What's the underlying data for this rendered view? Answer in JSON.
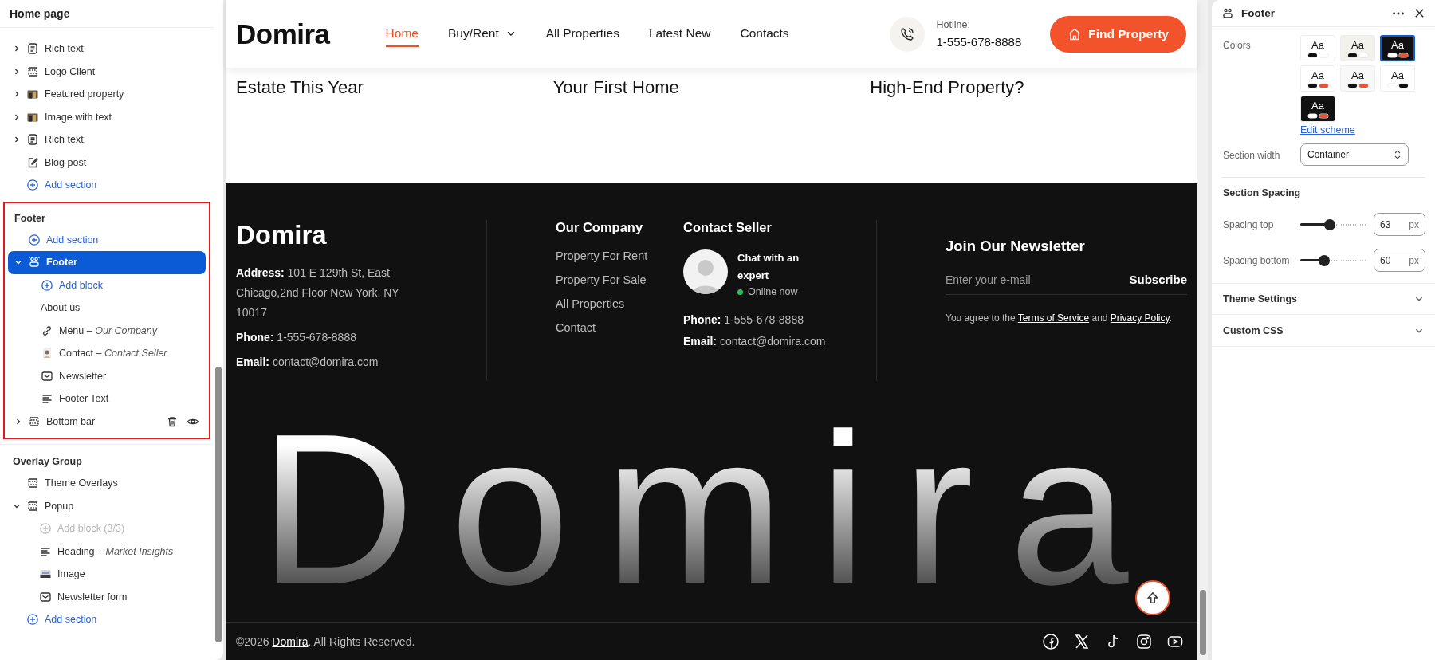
{
  "sidebar": {
    "title": "Home page",
    "sections": [
      {
        "kind": "richtext",
        "label": "Rich text",
        "expanded": false,
        "selected": false
      },
      {
        "kind": "group",
        "label": "Logo Client",
        "expanded": false,
        "selected": false
      },
      {
        "kind": "photo",
        "label": "Featured property",
        "expanded": false,
        "selected": false
      },
      {
        "kind": "photo",
        "label": "Image with text",
        "expanded": false,
        "selected": false
      },
      {
        "kind": "richtext",
        "label": "Rich text",
        "expanded": false,
        "selected": false
      },
      {
        "kind": "post",
        "label": "Blog post",
        "selected": false
      },
      {
        "kind": "add",
        "label": "Add section",
        "disabled": false
      }
    ],
    "groups": [
      {
        "title": "Footer",
        "highlighted": true,
        "items": [
          {
            "kind": "add",
            "label": "Add section",
            "disabled": false
          },
          {
            "kind": "people",
            "label": "Footer",
            "expanded": true,
            "selected": true,
            "children": [
              {
                "kind": "add",
                "label": "Add block",
                "disabled": false
              },
              {
                "kind": "plain",
                "label": "About us",
                "selected": false
              },
              {
                "kind": "link",
                "label": "Menu",
                "sep": "–",
                "note": "Our Company",
                "selected": false
              },
              {
                "kind": "avatar",
                "label": "Contact",
                "sep": "–",
                "note": "Contact Seller",
                "selected": false
              },
              {
                "kind": "mail",
                "label": "Newsletter",
                "selected": false
              },
              {
                "kind": "lines",
                "label": "Footer Text",
                "selected": false
              }
            ]
          },
          {
            "kind": "group",
            "label": "Bottom bar",
            "expanded": false,
            "selected": false,
            "actions_shown": true
          }
        ]
      },
      {
        "title": "Overlay Group",
        "highlighted": false,
        "items": [
          {
            "kind": "group",
            "label": "Theme Overlays",
            "selected": false
          },
          {
            "kind": "group",
            "label": "Popup",
            "expanded": true,
            "selected": false,
            "children": [
              {
                "kind": "add",
                "label": "Add block (3/3)",
                "disabled": true
              },
              {
                "kind": "lines",
                "label": "Heading",
                "sep": "–",
                "note": "Market Insights",
                "selected": false
              },
              {
                "kind": "image",
                "label": "Image",
                "selected": false
              },
              {
                "kind": "mail",
                "label": "Newsletter form",
                "selected": false
              }
            ]
          },
          {
            "kind": "add",
            "label": "Add section",
            "disabled": false
          }
        ]
      }
    ]
  },
  "site_header": {
    "logo": "Domira",
    "nav": [
      {
        "label": "Home",
        "selected": true
      },
      {
        "label": "Buy/Rent",
        "selected": false,
        "dropdown": true
      },
      {
        "label": "All Properties",
        "selected": false
      },
      {
        "label": "Latest New",
        "selected": false
      },
      {
        "label": "Contacts",
        "selected": false
      }
    ],
    "hotline_label": "Hotline:",
    "hotline": "1-555-678-8888",
    "cta": "Find Property"
  },
  "blog_titles": [
    "Estate This Year",
    "Your First Home",
    "High-End Property?"
  ],
  "footer": {
    "logo": "Domira",
    "about": [
      {
        "label": "Address:",
        "value": "101 E 129th St, East Chicago,2nd Floor New York, NY 10017"
      },
      {
        "label": "Phone:",
        "value": "1-555-678-8888"
      },
      {
        "label": "Email:",
        "value": "contact@domira.com"
      }
    ],
    "menu": {
      "title": "Our Company",
      "links": [
        "Property For Rent",
        "Property For Sale",
        "All Properties",
        "Contact"
      ]
    },
    "contact": {
      "title": "Contact Seller",
      "chat": "Chat with an expert",
      "status": "Online now",
      "online": true,
      "lines": [
        {
          "label": "Phone:",
          "value": "1-555-678-8888"
        },
        {
          "label": "Email:",
          "value": "contact@domira.com"
        }
      ]
    },
    "newsletter": {
      "title": "Join Our Newsletter",
      "placeholder": "Enter your e-mail",
      "button": "Subscribe",
      "consent": {
        "before": "You agree to the",
        "terms": "Terms of Service",
        "middle": "and",
        "privacy": "Privacy Policy",
        "after": "."
      }
    },
    "brand": "Domira",
    "copyright": {
      "year": "©2026",
      "brand": "Domira",
      "rest": ". All Rights Reserved."
    },
    "social": [
      {
        "kind": "facebook"
      },
      {
        "kind": "x"
      },
      {
        "kind": "tiktok"
      },
      {
        "kind": "instagram"
      },
      {
        "kind": "youtube"
      }
    ]
  },
  "settings": {
    "title": "Footer",
    "colors_label": "Colors",
    "schemes": [
      {
        "label": "Aa",
        "color": "#ffffff",
        "dots": [
          {
            "color": "#111111"
          },
          {
            "color": "#ffffff"
          }
        ],
        "selected": false
      },
      {
        "label": "Aa",
        "color": "#f3f1ec",
        "dots": [
          {
            "color": "#111111"
          },
          {
            "color": "#ffffff"
          }
        ],
        "selected": false
      },
      {
        "label": "Aa",
        "color": "#111111",
        "dots": [
          {
            "color": "#ffffff"
          },
          {
            "color": "#f0512d"
          }
        ],
        "selected": true
      },
      {
        "label": "Aa",
        "color": "#ffffff",
        "dots": [
          {
            "color": "#111111"
          },
          {
            "color": "#f0512d"
          }
        ],
        "selected": false
      },
      {
        "label": "Aa",
        "color": "#f8f8f8",
        "dots": [
          {
            "color": "#111111"
          },
          {
            "color": "#f0512d"
          }
        ],
        "selected": false
      },
      {
        "label": "Aa",
        "color": "#ffffff",
        "dots": [
          {
            "color": "#ffffff"
          },
          {
            "color": "#111111"
          }
        ],
        "selected": false
      },
      {
        "label": "Aa",
        "color": "#111111",
        "dots": [
          {
            "color": "#ffffff"
          },
          {
            "color": "#f0512d"
          }
        ],
        "selected": false
      }
    ],
    "edit_scheme": "Edit scheme",
    "width_label": "Section width",
    "width_value": "Container",
    "spacing_title": "Section Spacing",
    "sliders": [
      {
        "label": "Spacing top",
        "level": 0.45,
        "value": "63",
        "unit": "px"
      },
      {
        "label": "Spacing bottom",
        "level": 0.36,
        "value": "60",
        "unit": "px"
      }
    ],
    "panels": [
      {
        "label": "Theme Settings",
        "expanded": false
      },
      {
        "label": "Custom CSS",
        "expanded": false
      }
    ]
  }
}
